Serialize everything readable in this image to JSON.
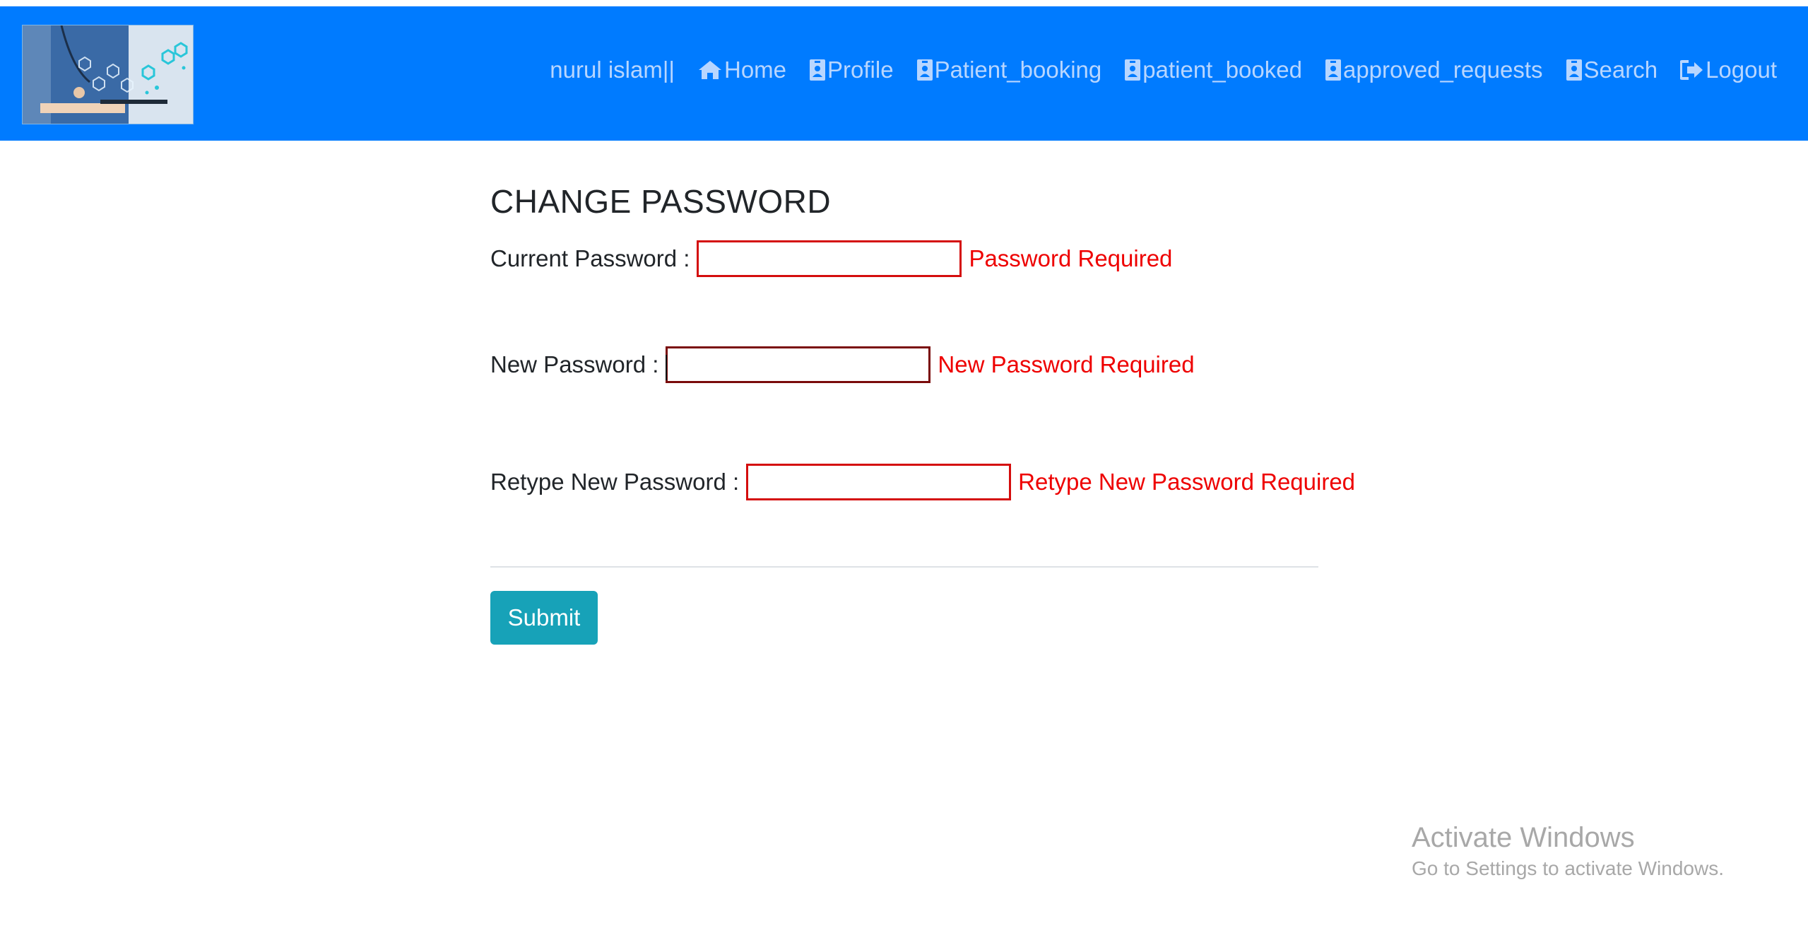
{
  "navbar": {
    "brand_color": "#007bff",
    "link_color": "#b8d6ff",
    "user": "nurul islam||",
    "items": [
      {
        "label": "Home",
        "icon": "home-icon"
      },
      {
        "label": "Profile",
        "icon": "id-badge-icon"
      },
      {
        "label": "Patient_booking",
        "icon": "id-badge-icon"
      },
      {
        "label": "patient_booked",
        "icon": "id-badge-icon"
      },
      {
        "label": "approved_requests",
        "icon": "id-badge-icon"
      },
      {
        "label": "Search",
        "icon": "id-badge-icon"
      },
      {
        "label": "Logout",
        "icon": "sign-out-icon"
      }
    ]
  },
  "form": {
    "title": "CHANGE PASSWORD",
    "fields": [
      {
        "label": "Current Password :",
        "value": "",
        "error": "Password Required"
      },
      {
        "label": "New Password :",
        "value": "",
        "error": "New Password Required"
      },
      {
        "label": "Retype New Password :",
        "value": "",
        "error": "Retype New Password Required"
      }
    ],
    "submit_label": "Submit",
    "error_color": "#ee0000",
    "submit_color": "#17a2b8"
  },
  "watermark": {
    "title": "Activate Windows",
    "subtitle": "Go to Settings to activate Windows."
  }
}
